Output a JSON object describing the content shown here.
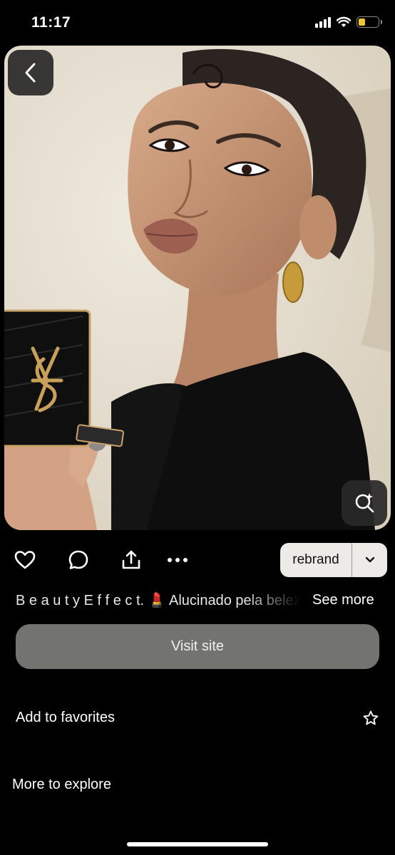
{
  "status_bar": {
    "time": "11:17",
    "battery_level": 0.35,
    "battery_color": "#f4c430"
  },
  "pin": {
    "image_icon": "photo-of-woman-with-makeup-compact",
    "back_icon": "chevron-left-icon",
    "lens_icon": "visual-search-icon"
  },
  "actions": {
    "like_icon": "heart-icon",
    "comment_icon": "speech-bubble-icon",
    "share_icon": "share-icon",
    "more_icon": "more-dots-icon",
    "board_name": "rebrand",
    "board_dropdown_icon": "chevron-down-icon"
  },
  "description": {
    "text": "B e a u t y E f f e c t. 💄 Alucinado pela beleza",
    "see_more": "See more"
  },
  "visit_site": {
    "label": "Visit site",
    "color": "#737370"
  },
  "favorites": {
    "label": "Add to favorites",
    "icon": "star-icon"
  },
  "explore": {
    "title": "More to explore"
  }
}
